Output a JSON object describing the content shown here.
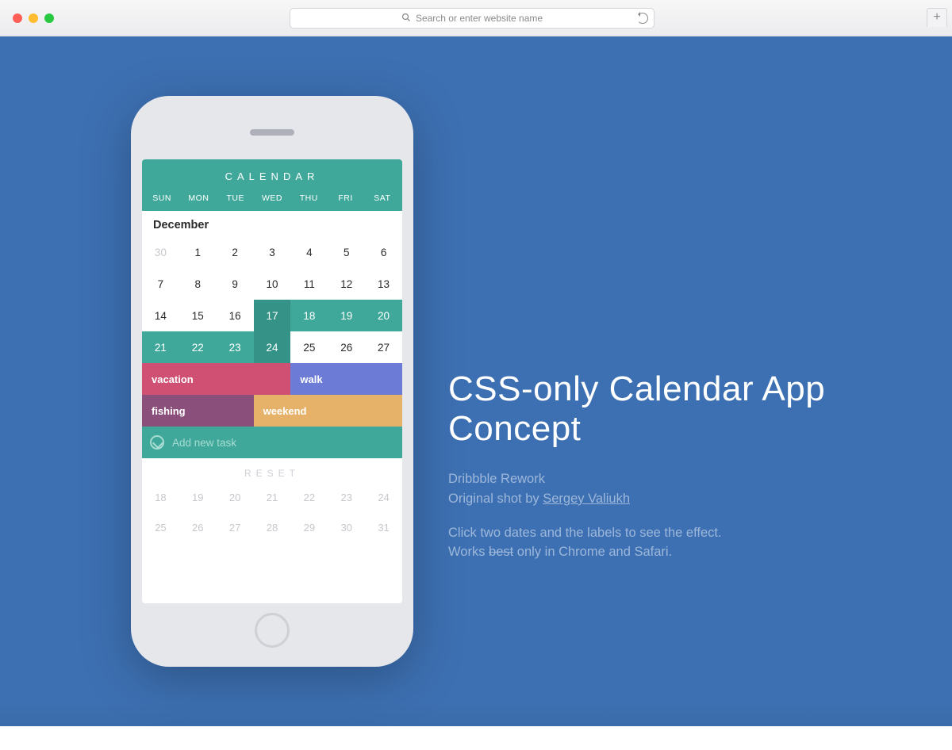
{
  "browser": {
    "placeholder": "Search or enter website name"
  },
  "page": {
    "headline": "CSS-only Calendar App Concept",
    "sub1": "Dribbble Rework",
    "sub2_prefix": "Original shot by ",
    "sub2_link": "Sergey Valiukh",
    "tip1": "Click two dates and the labels to see the effect.",
    "tip2_prefix": "Works ",
    "tip2_strike": "best",
    "tip2_suffix": " only in Chrome and Safari."
  },
  "calendar": {
    "title": "CALENDAR",
    "dow": [
      "SUN",
      "MON",
      "TUE",
      "WED",
      "THU",
      "FRI",
      "SAT"
    ],
    "month": "December",
    "prev_days": [
      "30"
    ],
    "days": [
      "1",
      "2",
      "3",
      "4",
      "5",
      "6",
      "7",
      "8",
      "9",
      "10",
      "11",
      "12",
      "13",
      "14",
      "15",
      "16",
      "17",
      "18",
      "19",
      "20",
      "21",
      "22",
      "23",
      "24",
      "25",
      "26",
      "27"
    ],
    "selected": [
      "17",
      "18",
      "19",
      "20",
      "21",
      "22",
      "23",
      "24"
    ],
    "selected_dark": [
      "17",
      "24"
    ],
    "bars": {
      "vacation": "vacation",
      "walk": "walk",
      "fishing": "fishing",
      "weekend": "weekend"
    },
    "newtask": "Add new task",
    "reset": "RESET",
    "mini_rows": [
      [
        "18",
        "19",
        "20",
        "21",
        "22",
        "23",
        "24"
      ],
      [
        "25",
        "26",
        "27",
        "28",
        "29",
        "30",
        "31"
      ]
    ]
  }
}
